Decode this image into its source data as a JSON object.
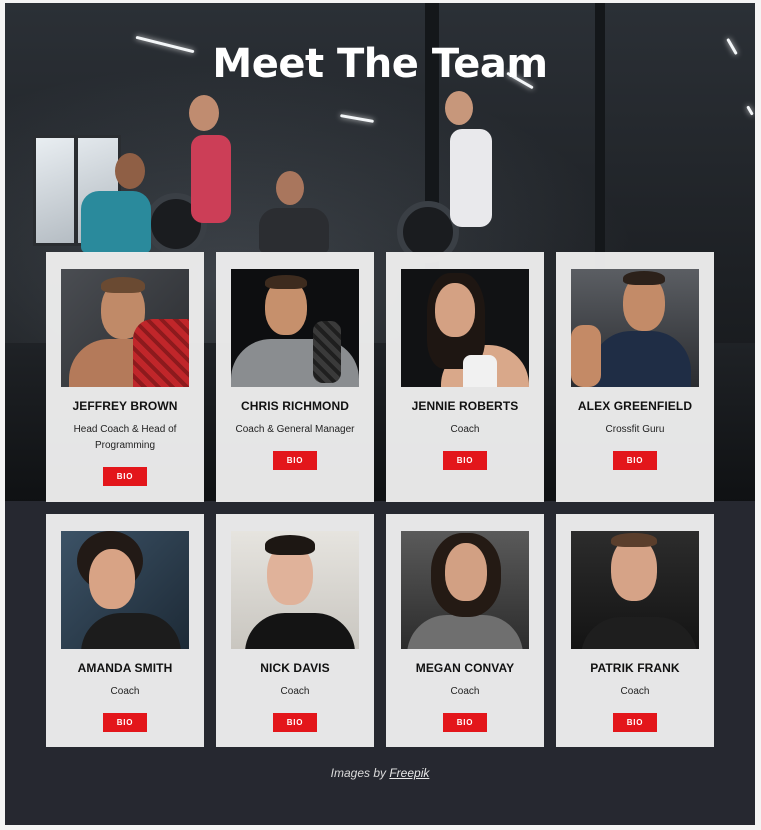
{
  "header": {
    "title": "Meet The Team"
  },
  "team": [
    {
      "name": "JEFFREY BROWN",
      "role": "Head Coach & Head of Programming",
      "bio_label": "BIO"
    },
    {
      "name": "CHRIS RICHMOND",
      "role": "Coach & General Manager",
      "bio_label": "BIO"
    },
    {
      "name": "JENNIE ROBERTS",
      "role": "Coach",
      "bio_label": "BIO"
    },
    {
      "name": "ALEX GREENFIELD",
      "role": "Crossfit Guru",
      "bio_label": "BIO"
    },
    {
      "name": "AMANDA SMITH",
      "role": "Coach",
      "bio_label": "BIO"
    },
    {
      "name": "NICK DAVIS",
      "role": "Coach",
      "bio_label": "BIO"
    },
    {
      "name": "MEGAN CONVAY",
      "role": "Coach",
      "bio_label": "BIO"
    },
    {
      "name": "PATRIK FRANK",
      "role": "Coach",
      "bio_label": "BIO"
    }
  ],
  "footer": {
    "credit_prefix": "Images by",
    "credit_link": "Freepik"
  },
  "colors": {
    "accent": "#e3161b",
    "background": "#262830",
    "card": "#eeeeee"
  }
}
